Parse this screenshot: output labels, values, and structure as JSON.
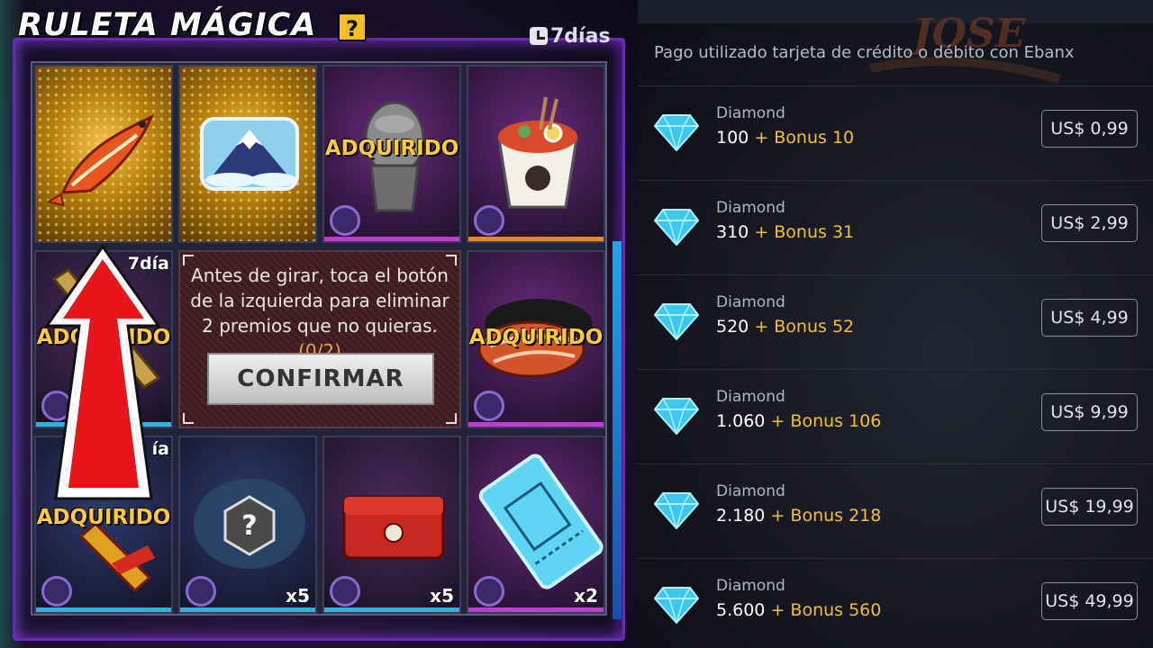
{
  "game": {
    "title": "RULETA MÁGICA",
    "help": "?",
    "days_label": "7días",
    "acquired": "ADQUIRIDO",
    "cell_days": "7día",
    "cell_days_cut": "ía",
    "mult_x5": "x5",
    "mult_x2": "x2",
    "instruction": "Antes de girar, toca el botón de la izquierda para eliminar 2 premios que no quieras.",
    "progress": "(0/2)",
    "confirm_label": "CONFIRMAR"
  },
  "store": {
    "logo_text": "JOSE",
    "note": "Pago utilizado tarjeta de crédito o débito con Ebanx",
    "packages": [
      {
        "label": "Diamond",
        "amount": "100",
        "bonus": "+ Bonus 10",
        "price": "US$ 0,99"
      },
      {
        "label": "Diamond",
        "amount": "310",
        "bonus": "+ Bonus 31",
        "price": "US$ 2,99"
      },
      {
        "label": "Diamond",
        "amount": "520",
        "bonus": "+ Bonus 52",
        "price": "US$ 4,99"
      },
      {
        "label": "Diamond",
        "amount": "1.060",
        "bonus": "+ Bonus 106",
        "price": "US$ 9,99"
      },
      {
        "label": "Diamond",
        "amount": "2.180",
        "bonus": "+ Bonus 218",
        "price": "US$ 19,99"
      },
      {
        "label": "Diamond",
        "amount": "5.600",
        "bonus": "+ Bonus 560",
        "price": "US$ 49,99"
      }
    ]
  },
  "colors": {
    "accent_gold": "#f1c232",
    "acquired_yellow": "#ffcc33",
    "arrow_red": "#e8141a",
    "frame_purple": "#6a2bb0"
  }
}
